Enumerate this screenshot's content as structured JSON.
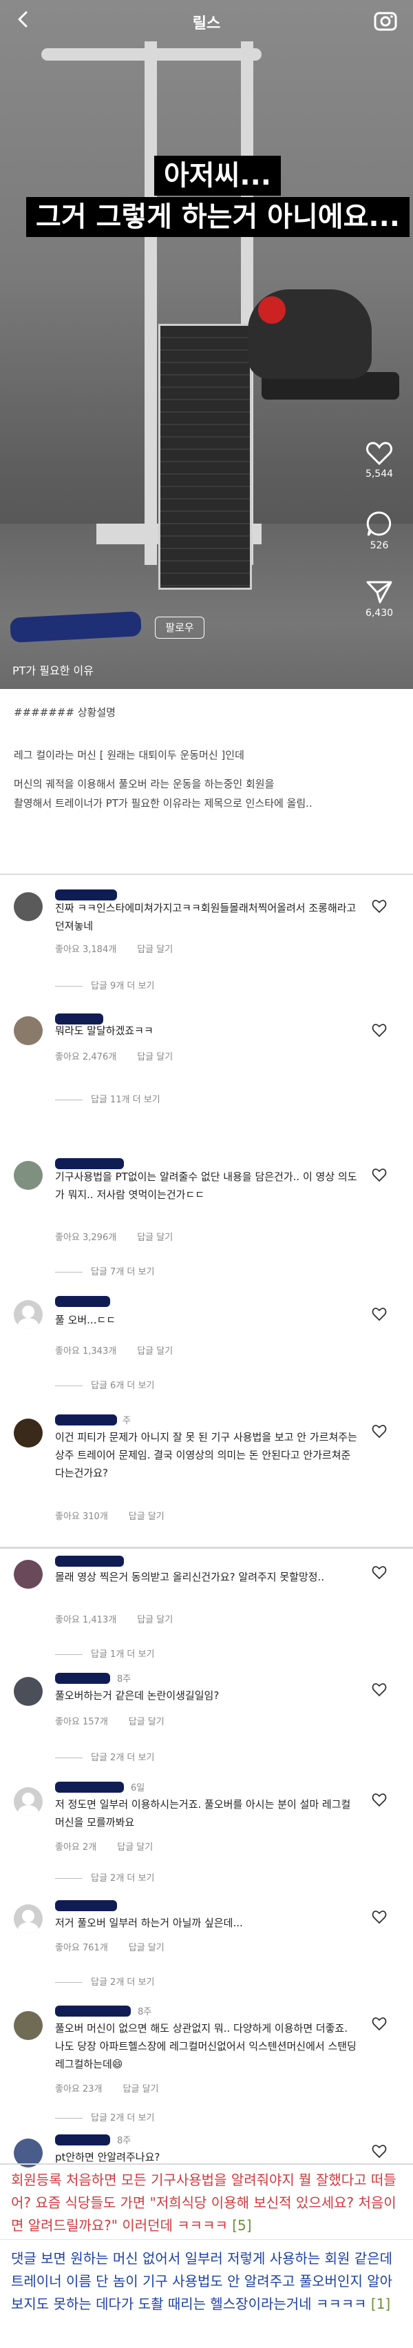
{
  "reels": {
    "title": "릴스",
    "caption_line1": "아저씨...",
    "caption_line2": "그거 그렇게 하는거 아니에요...",
    "likes": "5,544",
    "comments": "526",
    "shares": "6,430",
    "follow_label": "팔로우",
    "post_caption": "PT가 필요한 이유"
  },
  "situation": {
    "heading": "####### 상황설명",
    "line1": "레그 컬이라는 머신 [ 원래는 대퇴이두 운동머신 ]인데",
    "line2": "머신의 궤적을 이용해서 풀오버 라는 운동을 하는중인 회원을",
    "line3": "촬영해서 트레이너가 PT가 필요한 이유라는 제목으로 인스타에 올림.."
  },
  "comments": [
    {
      "text": "진짜 ㅋㅋ인스타에미쳐가지고ㅋㅋ회원들몰래처찍어올려서 조롱해라고 던져놓네",
      "likes": "좋아요 3,184개",
      "reply": "답글 달기",
      "more": "답글 9개 더 보기",
      "time": ""
    },
    {
      "text": "뭐라도 말달하겠죠ㅋㅋ",
      "likes": "좋아요 2,476개",
      "reply": "답글 달기",
      "more": "답글 11개 더 보기",
      "time": ""
    },
    {
      "text": "기구사용법을 PT없이는 알려줄수 없단 내용을 담은건가.. 이 영상 의도가 뭐지.. 저사람 엿먹이는건가ㄷㄷ",
      "likes": "좋아요 3,296개",
      "reply": "답글 달기",
      "more": "답글 7개 더 보기",
      "time": ""
    },
    {
      "text": "풀 오버...ㄷㄷ",
      "likes": "좋아요 1,343개",
      "reply": "답글 달기",
      "more": "답글 6개 더 보기",
      "time": ""
    },
    {
      "text": "이건 피티가 문제가 아니지 잘 못 된 기구 사용법을 보고 안 가르쳐주는 상주 트레이어 문제임. 결국 이영상의 의미는 돈 안된다고 안가르쳐준다는건가요?",
      "likes": "좋아요 310개",
      "reply": "답글 달기",
      "more": "",
      "time": "주"
    },
    {
      "text": "몰래 영상 찍은거 동의받고 올리신건가요? 알려주지 못할망정..",
      "likes": "좋아요 1,413개",
      "reply": "답글 달기",
      "more": "답글 1개 더 보기",
      "time": ""
    },
    {
      "text": "풀오버하는거 같은데 논란이생길일임?",
      "likes": "좋아요 157개",
      "reply": "답글 달기",
      "more": "답글 2개 더 보기",
      "time": "8주"
    },
    {
      "text": "저 정도면 일부러 이용하시는거죠. 풀오버를 아시는 분이 설마 레그컬 머신을 모를까봐요",
      "likes": "좋아요 2개",
      "reply": "답글 달기",
      "more": "답글 2개 더 보기",
      "time": "6일"
    },
    {
      "text": "저거 풀오버 일부러 하는거 아닐까 싶은데...",
      "likes": "좋아요 761개",
      "reply": "답글 달기",
      "more": "답글 2개 더 보기",
      "time": ""
    },
    {
      "text": "풀오버 머신이 없으면 해도 상관없지 뭐.. 다양하게 이용하면 더좋죠. 나도 당장 아파트헬스장에 레그컬머신없어서 익스텐션머신에서 스탠딩레그컬하는데😄",
      "likes": "좋아요 23개",
      "reply": "답글 달기",
      "more": "답글 2개 더 보기",
      "time": "8주"
    },
    {
      "text": "pt안하면 안알려주나요?",
      "likes": "",
      "reply": "",
      "more": "",
      "time": "8주"
    }
  ],
  "community": {
    "c1_text": "회원등록 처음하면 모든 기구사용법을 알려줘야지 뭘 잘했다고 떠들어? 요즘 식당들도 가면 \"저희식당 이용해 보신적 있으세요? 처음이면 알려드릴까요?\" 이러던데 ㅋㅋㅋㅋ",
    "c1_tag": "[5]",
    "c2_text": "댓글 보면 원하는 머신 없어서 일부러 저렇게 사용하는 회원 같은데 트레이너 이름 단 놈이 기구 사용법도 안 알려주고 풀오버인지 알아보지도 못하는 데다가 도촬 때리는 헬스장이라는거네 ㅋㅋㅋㅋ",
    "c2_tag": "[1]"
  },
  "colors": {
    "red": "#d3393d",
    "blue": "#1d41a8",
    "green": "#6c8f3a"
  }
}
